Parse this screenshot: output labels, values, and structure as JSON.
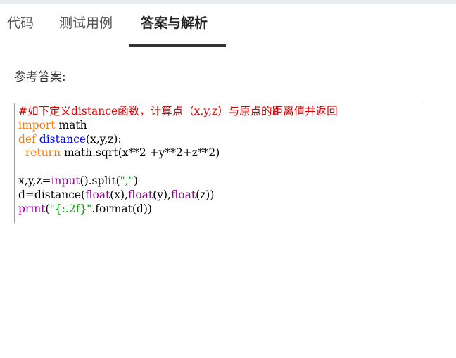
{
  "tabs": [
    {
      "label": "代码",
      "active": false
    },
    {
      "label": "测试用例",
      "active": false
    },
    {
      "label": "答案与解析",
      "active": true
    }
  ],
  "answer": {
    "label": "参考答案:"
  },
  "code": {
    "line1": "#如下定义distance函数，计算点（x,y,z）与原点的距离值并返回",
    "line2_kw": "import",
    "line2_rest": " math",
    "line3_kw": "def",
    "line3_fn": "distance",
    "line3_rest": "(x,y,z):",
    "line4_indent": "  ",
    "line4_kw": "return",
    "line4_rest": " math.sqrt(x**2 +y**2+z**2)",
    "line6_a": "x,y,z=",
    "line6_builtin": "input",
    "line6_b": "().split(",
    "line6_str": "\",\"",
    "line6_c": ")",
    "line7_a": "d=distance(",
    "line7_b1": "float",
    "line7_c1": "(x),",
    "line7_b2": "float",
    "line7_c2": "(y),",
    "line7_b3": "float",
    "line7_c3": "(z))",
    "line8_builtin": "print",
    "line8_a": "(",
    "line8_str": "\"{:.2f}\"",
    "line8_b": ".format(d))"
  },
  "colors": {
    "comment": "#dd0000",
    "keyword": "#ff7700",
    "function_name": "#0000ff",
    "builtin": "#900090",
    "string": "#00aa00"
  }
}
